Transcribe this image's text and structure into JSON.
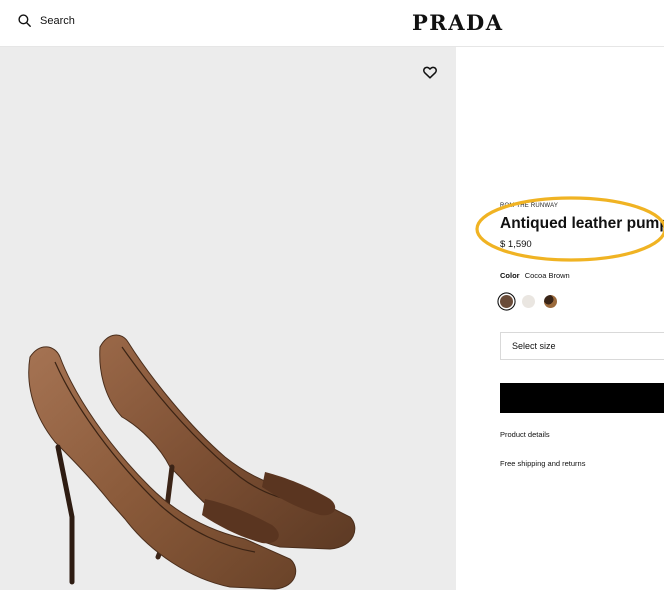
{
  "header": {
    "search_label": "Search",
    "brand": "PRADA"
  },
  "product": {
    "eyebrow": "ROM THE RUNWAY",
    "title": "Antiqued leather pumps",
    "price": "$ 1,590",
    "color_label": "Color",
    "color_value": "Cocoa Brown",
    "swatches": [
      {
        "name": "Cocoa Brown",
        "hex": "#6a4c39",
        "selected": true
      },
      {
        "name": "Light",
        "hex": "#eae6e1",
        "selected": false
      },
      {
        "name": "Dark Brown",
        "hex": "#3a2518",
        "selected": false
      }
    ],
    "size_placeholder": "Select size",
    "links": [
      "Product details",
      "Free shipping and returns"
    ]
  },
  "colors": {
    "highlight": "#f0b323",
    "gallery_bg": "#ececec",
    "leather": "#8a5a3a"
  },
  "icons": {
    "search": "search-icon",
    "wishlist": "heart-icon"
  }
}
